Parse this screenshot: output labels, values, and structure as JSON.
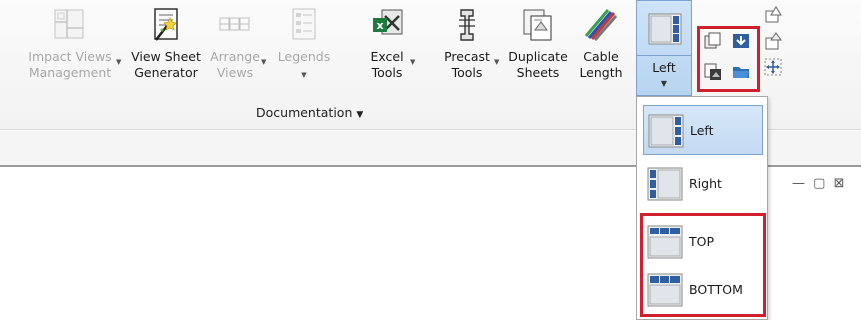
{
  "ribbon": {
    "buttons": [
      {
        "id": "impact",
        "line1": "Impact Views",
        "line2": "Management",
        "icon": "floorplan-icon",
        "enabled": false,
        "has_dropdown": true
      },
      {
        "id": "viewsheet",
        "line1": "View Sheet",
        "line2": "Generator",
        "icon": "magic-sheet-icon",
        "enabled": true,
        "has_dropdown": false
      },
      {
        "id": "arrange",
        "line1": "Arrange",
        "line2": "Views",
        "icon": "grid-icon",
        "enabled": false,
        "has_dropdown": true
      },
      {
        "id": "legends",
        "line1": "Legends",
        "line2": "",
        "icon": "legend-icon",
        "enabled": false,
        "has_dropdown": true
      },
      {
        "id": "excel",
        "line1": "Excel",
        "line2": "Tools",
        "icon": "excel-icon",
        "enabled": true,
        "has_dropdown": true
      },
      {
        "id": "precast",
        "line1": "Precast",
        "line2": "Tools",
        "icon": "precast-icon",
        "enabled": true,
        "has_dropdown": true
      },
      {
        "id": "duplicate",
        "line1": "Duplicate",
        "line2": "Sheets",
        "icon": "duplicate-sheets-icon",
        "enabled": true,
        "has_dropdown": false
      },
      {
        "id": "cable",
        "line1": "Cable",
        "line2": "Length",
        "icon": "cable-icon",
        "enabled": true,
        "has_dropdown": false
      }
    ],
    "panel_title": "Documentation",
    "split_button": {
      "label": "Left",
      "icon": "layout-left-icon"
    },
    "small_icons": [
      "copy-views-icon",
      "import-icon",
      "paste-views-icon",
      "open-folder-icon",
      "sheet-up-icon",
      "sheet-down-icon",
      "move-icon"
    ]
  },
  "dropdown": {
    "items": [
      {
        "label": "Left",
        "icon": "layout-left-icon",
        "selected": true
      },
      {
        "label": "Right",
        "icon": "layout-right-icon",
        "selected": false
      },
      {
        "label": "TOP",
        "icon": "layout-top-icon",
        "selected": false
      },
      {
        "label": "BOTTOM",
        "icon": "layout-bottom-icon",
        "selected": false
      }
    ]
  },
  "window_controls": {
    "minimize": "—",
    "restore": "▢",
    "close": "⊠"
  },
  "colors": {
    "highlight_red": "#d0202e",
    "selected_blue": "#c3daf3",
    "disabled_text": "#a8a8a8"
  }
}
